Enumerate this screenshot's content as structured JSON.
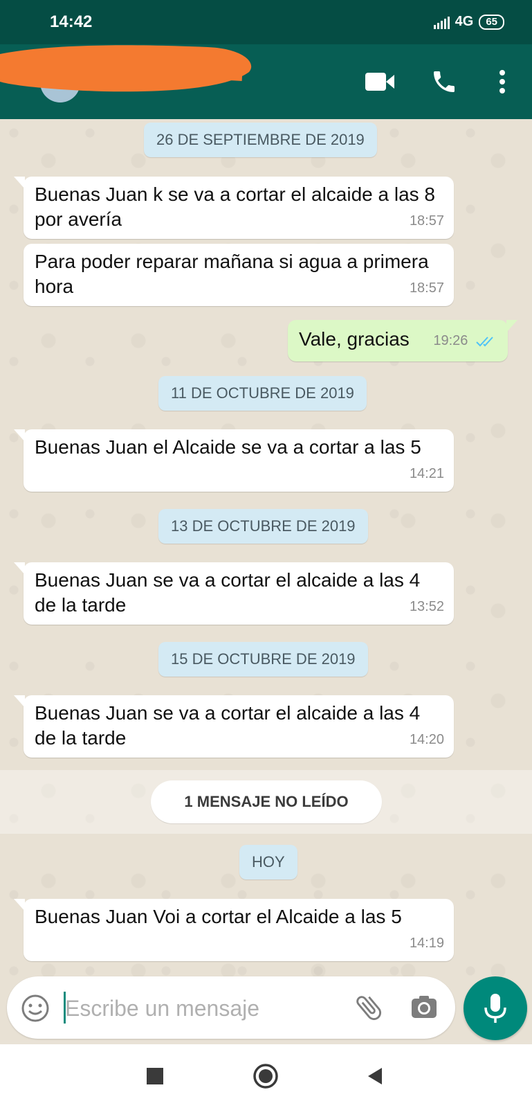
{
  "status_bar": {
    "time": "14:42",
    "network": "4G",
    "battery": "65"
  },
  "chat": {
    "contact_name": "",
    "date_chips": [
      "26 DE SEPTIEMBRE DE 2019",
      "11 DE OCTUBRE DE 2019",
      "13 DE OCTUBRE DE 2019",
      "15 DE OCTUBRE DE 2019",
      "HOY"
    ],
    "messages": [
      {
        "direction": "in",
        "text": "Buenas Juan k se va a cortar el alcaide a las 8 por avería",
        "time": "18:57"
      },
      {
        "direction": "in",
        "text": "Para poder reparar mañana si agua a primera hora",
        "time": "18:57"
      },
      {
        "direction": "out",
        "text": "Vale, gracias",
        "time": "19:26",
        "status": "read"
      },
      {
        "direction": "in",
        "text": "Buenas Juan el Alcaide se va a cortar a las 5",
        "time": "14:21"
      },
      {
        "direction": "in",
        "text": "Buenas Juan se va a cortar el alcaide a las 4 de la tarde",
        "time": "13:52"
      },
      {
        "direction": "in",
        "text": "Buenas Juan se va a cortar el alcaide a las 4 de la tarde",
        "time": "14:20"
      },
      {
        "direction": "in",
        "text": "Buenas Juan Voi a cortar el Alcaide a las 5",
        "time": "14:19"
      }
    ],
    "unread_label": "1 MENSAJE NO LEÍDO"
  },
  "composer": {
    "placeholder": "Escribe un mensaje",
    "value": ""
  },
  "colors": {
    "header": "#075e54",
    "status_bar": "#054d44",
    "outgoing_bubble": "#dcf8c6",
    "date_chip": "#d4eaf4",
    "accent": "#00897b",
    "read_ticks": "#4fc3f7"
  },
  "icons": [
    "video-call-icon",
    "phone-icon",
    "more-vert-icon",
    "emoji-icon",
    "attach-icon",
    "camera-icon",
    "mic-icon",
    "nav-recents-icon",
    "nav-home-icon",
    "nav-back-icon"
  ]
}
